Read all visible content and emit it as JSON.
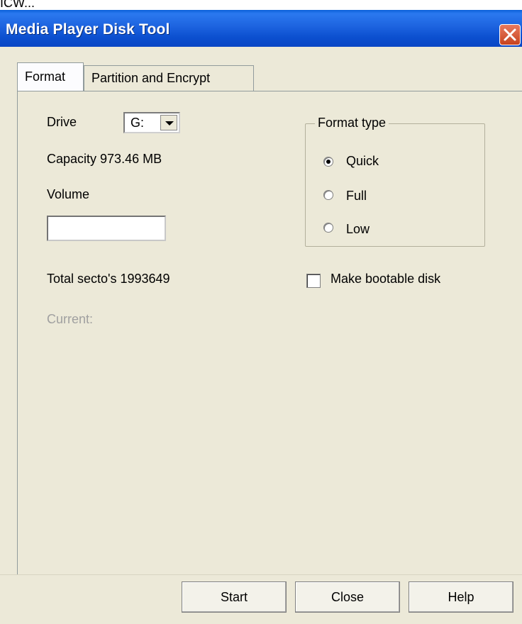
{
  "window": {
    "title": "Media Player Disk Tool",
    "top_text_fragment": "ICW..."
  },
  "tabs": [
    {
      "label": "Format",
      "active": true
    },
    {
      "label": "Partition and Encrypt",
      "active": false
    }
  ],
  "format": {
    "drive_label": "Drive",
    "drive_value": "G:",
    "capacity_text": "Capacity 973.46 MB",
    "volume_label": "Volume",
    "volume_value": "",
    "total_sectors_text": "Total secto's 1993649",
    "current_text": "Current:"
  },
  "format_type": {
    "title": "Format type",
    "options": [
      {
        "label": "Quick",
        "selected": true
      },
      {
        "label": "Full",
        "selected": false
      },
      {
        "label": "Low",
        "selected": false
      }
    ]
  },
  "bootable": {
    "label": "Make bootable disk",
    "checked": false
  },
  "buttons": {
    "start": "Start",
    "close": "Close",
    "help": "Help"
  },
  "colors": {
    "title_bar": "#1d63df",
    "dialog": "#ece9d8",
    "close_button": "#d6552f"
  }
}
